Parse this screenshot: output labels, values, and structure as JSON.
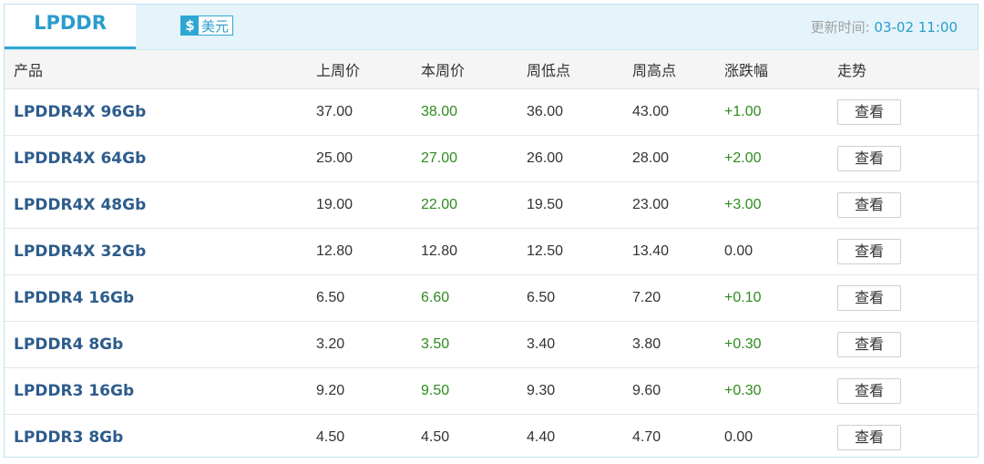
{
  "header": {
    "tab_label": "LPDDR",
    "currency_symbol": "$",
    "currency_label": "美元",
    "updated_prefix": "更新时间: ",
    "updated_time": "03-02 11:00"
  },
  "table": {
    "columns": [
      "产品",
      "上周价",
      "本周价",
      "周低点",
      "周高点",
      "涨跌幅",
      "走势"
    ],
    "view_label": "查看",
    "rows": [
      {
        "product": "LPDDR4X 96Gb",
        "last_week": "37.00",
        "this_week": "38.00",
        "week_low": "36.00",
        "week_high": "43.00",
        "change": "+1.00",
        "up": true
      },
      {
        "product": "LPDDR4X 64Gb",
        "last_week": "25.00",
        "this_week": "27.00",
        "week_low": "26.00",
        "week_high": "28.00",
        "change": "+2.00",
        "up": true
      },
      {
        "product": "LPDDR4X 48Gb",
        "last_week": "19.00",
        "this_week": "22.00",
        "week_low": "19.50",
        "week_high": "23.00",
        "change": "+3.00",
        "up": true
      },
      {
        "product": "LPDDR4X 32Gb",
        "last_week": "12.80",
        "this_week": "12.80",
        "week_low": "12.50",
        "week_high": "13.40",
        "change": "0.00",
        "up": false
      },
      {
        "product": "LPDDR4 16Gb",
        "last_week": "6.50",
        "this_week": "6.60",
        "week_low": "6.50",
        "week_high": "7.20",
        "change": "+0.10",
        "up": true
      },
      {
        "product": "LPDDR4 8Gb",
        "last_week": "3.20",
        "this_week": "3.50",
        "week_low": "3.40",
        "week_high": "3.80",
        "change": "+0.30",
        "up": true
      },
      {
        "product": "LPDDR3 16Gb",
        "last_week": "9.20",
        "this_week": "9.50",
        "week_low": "9.30",
        "week_high": "9.60",
        "change": "+0.30",
        "up": true
      },
      {
        "product": "LPDDR3 8Gb",
        "last_week": "4.50",
        "this_week": "4.50",
        "week_low": "4.40",
        "week_high": "4.70",
        "change": "0.00",
        "up": false
      }
    ]
  },
  "colors": {
    "accent": "#2fa7d3",
    "product_name": "#2d5c8c",
    "up_green": "#2e8b1e",
    "neutral_text": "#333333"
  }
}
